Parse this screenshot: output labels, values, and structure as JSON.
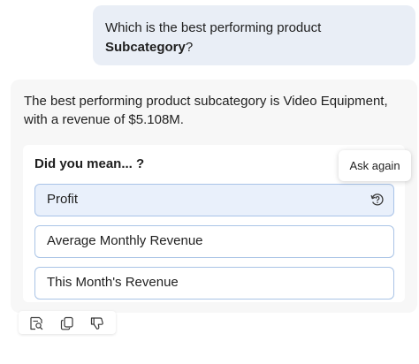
{
  "user_message": {
    "line1": "Which is the best performing product",
    "bold_word": "Subcategory",
    "suffix": "?"
  },
  "assistant_message": {
    "text": "The best performing product subcategory is Video Equipment, with a revenue of $5.108M."
  },
  "suggestions": {
    "title": "Did you mean... ?",
    "options": [
      "Profit",
      "Average Monthly Revenue",
      "This Month's Revenue"
    ],
    "tooltip": "Ask again"
  },
  "toolbar": {
    "icons": [
      "inspect-icon",
      "copy-icon",
      "thumbs-down-icon"
    ]
  },
  "colors": {
    "user_bubble": "#e9eef6",
    "panel": "#f7f7f7",
    "option_border": "#aac4e6",
    "option_active_bg": "#e9f0fb"
  }
}
